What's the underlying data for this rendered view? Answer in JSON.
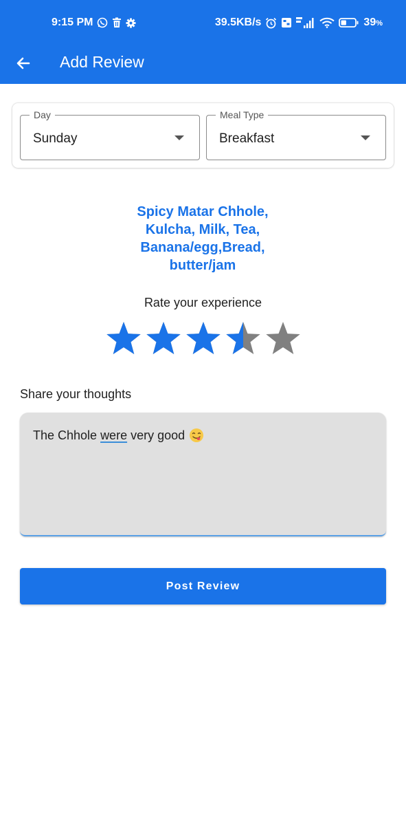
{
  "status_bar": {
    "time": "9:15 PM",
    "network_speed": "39.5KB/s",
    "battery_percent": "39",
    "battery_symbol": "%",
    "icons": [
      "whatsapp-icon",
      "delete-icon",
      "settings-icon",
      "alarm-icon",
      "volte-icon",
      "cell-signal-icon",
      "wifi-icon",
      "battery-icon"
    ],
    "battery_level": 0.39
  },
  "header": {
    "title": "Add Review",
    "back_icon": "arrow-back-icon"
  },
  "selectors": {
    "day": {
      "label": "Day",
      "value": "Sunday"
    },
    "meal_type": {
      "label": "Meal Type",
      "value": "Breakfast"
    }
  },
  "meal": {
    "lines": [
      "Spicy Matar Chhole,",
      "Kulcha, Milk, Tea,",
      "Banana/egg,Bread,",
      "butter/jam"
    ]
  },
  "rating": {
    "label": "Rate your experience",
    "value": 3.5,
    "max": 5,
    "filled_color": "#1a73e8",
    "empty_color": "#808080"
  },
  "thoughts": {
    "label": "Share your thoughts",
    "text_before": "The Chhole ",
    "text_underlined": "were",
    "text_after": " very good",
    "emoji": "face-savoring-food-emoji"
  },
  "actions": {
    "post_label": "Post Review"
  },
  "colors": {
    "primary": "#1a73e8",
    "field_bg": "#e0e0e0"
  }
}
